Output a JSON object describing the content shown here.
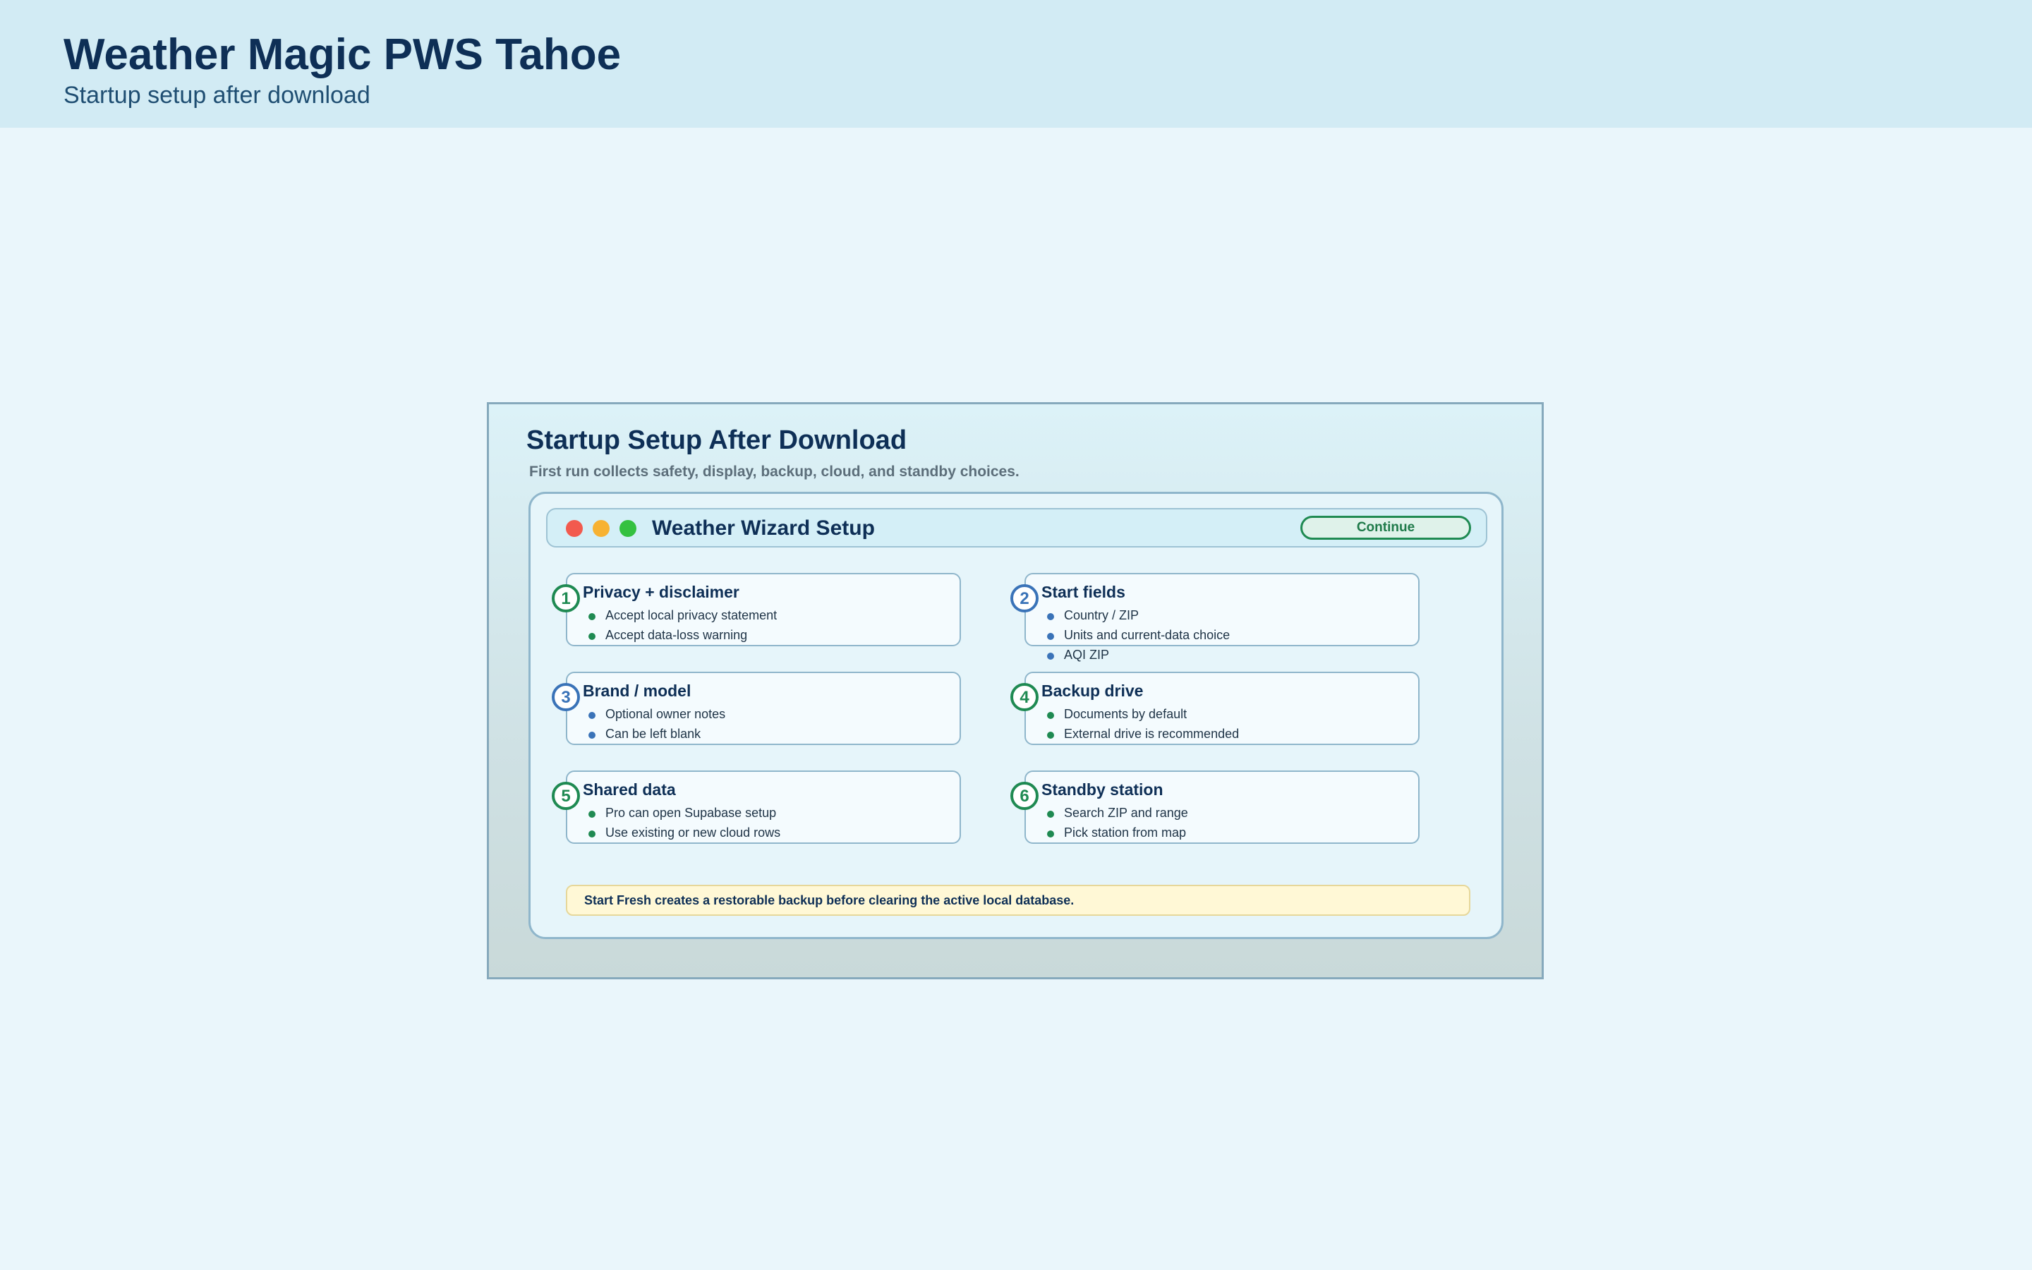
{
  "header": {
    "title": "Weather Magic PWS Tahoe",
    "subtitle": "Startup setup after download"
  },
  "frame": {
    "title": "Startup Setup After Download",
    "subtitle": "First run collects safety, display, backup, cloud, and standby choices."
  },
  "wizard": {
    "window_title": "Weather Wizard Setup",
    "continue_label": "Continue",
    "steps": [
      {
        "number": "1",
        "title": "Privacy + disclaimer",
        "accent": "#1f8a52",
        "items": [
          "Accept local privacy statement",
          "Accept data-loss warning"
        ]
      },
      {
        "number": "2",
        "title": "Start fields",
        "accent": "#3a73b8",
        "items": [
          "Country / ZIP",
          "Units and current-data choice",
          "AQI ZIP"
        ]
      },
      {
        "number": "3",
        "title": "Brand / model",
        "accent": "#3a73b8",
        "items": [
          "Optional owner notes",
          "Can be left blank"
        ]
      },
      {
        "number": "4",
        "title": "Backup drive",
        "accent": "#1f8a52",
        "items": [
          "Documents by default",
          "External drive is recommended"
        ]
      },
      {
        "number": "5",
        "title": "Shared data",
        "accent": "#1f8a52",
        "items": [
          "Pro can open Supabase setup",
          "Use existing or new cloud rows"
        ]
      },
      {
        "number": "6",
        "title": "Standby station",
        "accent": "#1f8a52",
        "items": [
          "Search ZIP and range",
          "Pick station from map"
        ]
      }
    ],
    "note": "Start Fresh creates a restorable backup before clearing the active local database."
  },
  "colors": {
    "title": "#0e2f56",
    "green_accent": "#1f8a52",
    "blue_accent": "#3a73b8",
    "note_background": "#fff8d6",
    "traffic_red": "#f25a4e",
    "traffic_yellow": "#f7b232",
    "traffic_green": "#34c140"
  }
}
